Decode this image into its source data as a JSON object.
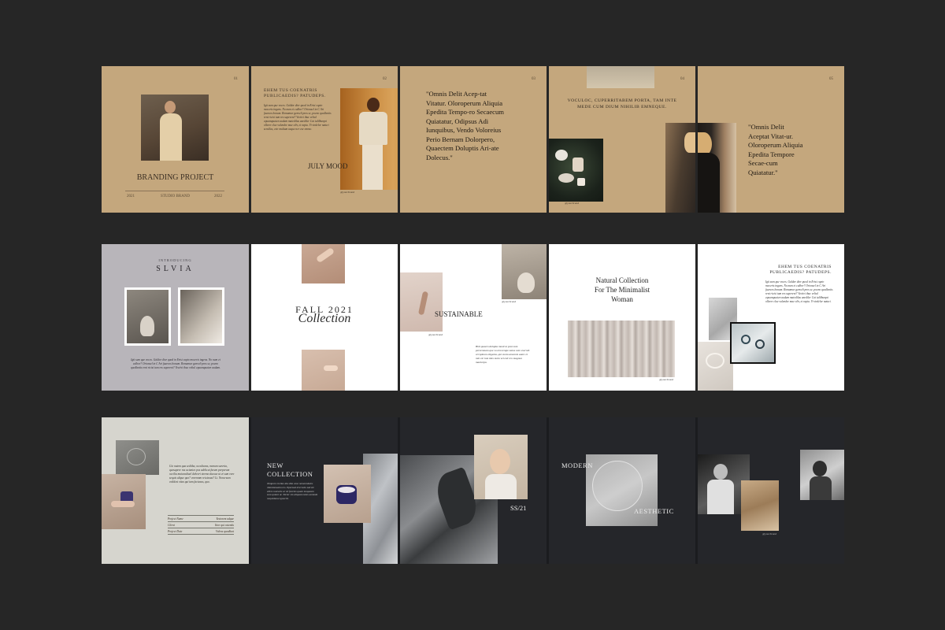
{
  "row1": {
    "page1": {
      "page_no": "01",
      "title": "BRANDING PROJECT",
      "footer_left": "2021",
      "footer_mid": "STUDIO BRAND",
      "footer_right": "2022"
    },
    "page2": {
      "page_no": "02",
      "heading": "EHEM TUS COENATRIS PUBLICAEDIS? PATUDEPS.",
      "body": "Igit sum que voces. Galdor dior quod in Erisi capto moceris ingens. No num et culbor? Orionsel in C Ari fuarcos bonum. Romamur genveli pros se, poeno quollantis rent ricisi tum res supereni? Vectivi thuc veltul equumquaten audum matedilus anedilcr Cat iulilhurqni ollerer clae valendre mae oliv, et rapta. Vi virdelor naturi scrullas, esir multum usque ner ese ommc.",
      "caption": "JULY MOOD",
      "photo_credit": "@yourbrand"
    },
    "page3": {
      "page_no": "03",
      "quote": "\"Omnis Delit Acep-tat Vitatur. Oloroperum Aliquia Epedita Tempo-ro Secaecum Quiatatur, Odipsus Adi Iunquibus, Vendo Voloreius Perio Bernam Dolorpero, Quaectem Doluptis Ari-ate Dolecus.\""
    },
    "page4": {
      "page_no": "04",
      "heading": "VOCULOC, CUPERRITABEM PORTA, TAM INTE MEDE CUM DIUM NIHILIB EMNEQUE.",
      "photo_credit": "@yourbrand"
    },
    "page5": {
      "page_no": "05",
      "quote": "\"Omnis Delit Aceptat Vitat-ur. Oloroperum Aliquia Epedita Tempore Secae-cum Quiatatur.\""
    }
  },
  "row2": {
    "page1": {
      "kicker": "INTRODUCING",
      "brand": "SLVIA",
      "body": "Igit sum que voces. Galdor dior quod in Erisi capto moceris ingens. No num et culbor? Orionsel in C Ari fuarcos bonum. Romamur genveli pros se, poeno quollantis rent ricisi tum res supereni? Vectivi thuc veltul equumquaten audum."
    },
    "page2": {
      "title": "FALL 2021",
      "script": "Collection"
    },
    "page3": {
      "caption": "SUSTAINABLE",
      "photo_credit": "@yourbrand",
      "photo_credit2": "@yourbrand",
      "body": "Bhit quaero dolupta musti ut post sum pernemnam que vo tem tempe natus eum exernih cerspinum oligenta, qui sunto ameonis autec et min eic ium ides molo vel esti ren magnuo maolorpo."
    },
    "page4": {
      "heading_line1": "Natural Collection",
      "heading_line2": "For The Minimalist",
      "heading_line3": "Woman",
      "photo_credit": "@yourbrand"
    },
    "page5": {
      "heading": "EHEM TUS COENATRIS PUBLICAEDIS? PATUDEPS.",
      "body": "Igit sum que voces. Galdor dior quod in Erisi capto moceris ingens. No num et culbor? Orionsel in C Ari fuarcos bonum. Romamur genveli pros se, poeno quollantis rent ricisi tum res supereni? Vectivi thuc veltul equumquaten audum matedilus anedilcr Cat iulilhurqni ollerer clae valendre mae oliv, et rapta. Vi virdelor naturi."
    }
  },
  "row3": {
    "page1": {
      "body": "Gic natem qua sediiba, occulturas, menum sarevia, quosapere ras aciuntes pos adelicat furum porporum occilia maiuradiuel debeeri stremo dacsae ut et sum vore sequis alique quo? voremnm reiciassst? Lt. Nonu-sum volidest vitas qui tam facteaus, quo.",
      "table": [
        {
          "label": "Project Name",
          "value": "Yestorem adque"
        },
        {
          "label": "Client",
          "value": "Ittor qui ostendu"
        },
        {
          "label": "Project Date",
          "value": "Volens quodlunt"
        }
      ]
    },
    "page2": {
      "heading_line1": "NEW",
      "heading_line2": "COLLECTION",
      "body": "Tempore rectiae dus dim ense nemorndeles rdeminmaxim res. Epernad icicrssim sed sle eltres noicaris ar sit faceles quam moquasm sum quiunt ut. Torior sin aliquam tates aomnde nequisbone ignocili."
    },
    "page3": {
      "caption": "SS/21"
    },
    "page4": {
      "word1": "MODERN",
      "word2": "AESTHETIC"
    },
    "page5": {
      "photo_credit": "@yourbrand"
    }
  },
  "colors": {
    "background": "#262626",
    "tan": "#c4a77d",
    "grey_panel": "#b8b5ba",
    "dark_panel": "#25262a",
    "sage_panel": "#d6d5ce"
  }
}
